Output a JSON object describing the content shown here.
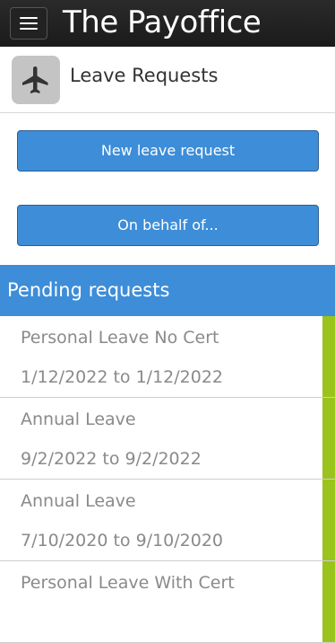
{
  "app": {
    "title": "The Payoffice"
  },
  "header": {
    "title": "Leave Requests",
    "icon": "airplane-icon"
  },
  "actions": {
    "new_label": "New leave request",
    "behalf_label": "On behalf of..."
  },
  "pending": {
    "title": "Pending requests",
    "status_color": "#9bc31d",
    "items": [
      {
        "type": "Personal Leave No Cert",
        "dates": "1/12/2022 to 1/12/2022"
      },
      {
        "type": "Annual Leave",
        "dates": "9/2/2022 to 9/2/2022"
      },
      {
        "type": "Annual Leave",
        "dates": "7/10/2020 to 9/10/2020"
      },
      {
        "type": "Personal Leave With Cert",
        "dates": ""
      }
    ]
  },
  "colors": {
    "accent": "#3d8dd8",
    "topbar": "#1f1f1f"
  }
}
